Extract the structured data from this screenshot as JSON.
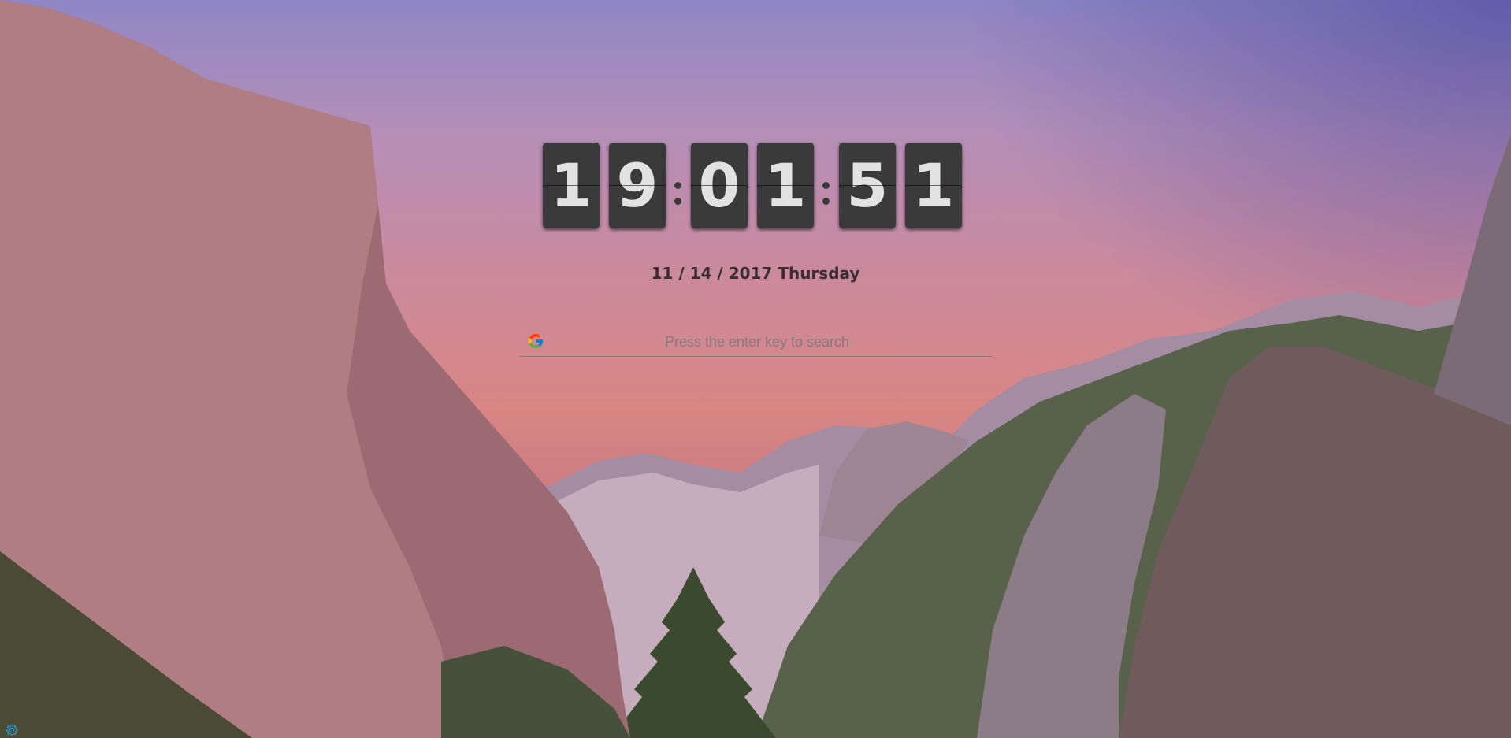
{
  "clock": {
    "h1": "1",
    "h2": "9",
    "m1": "0",
    "m2": "1",
    "s1": "5",
    "s2": "1"
  },
  "date": {
    "text": "11 / 14 / 2017 Thursday"
  },
  "search": {
    "placeholder": "Press the enter key to search",
    "value": "",
    "engine_icon": "google-icon"
  },
  "settings": {
    "icon": "gear-icon"
  },
  "colors": {
    "digit_bg": "#3a3a3a",
    "digit_text": "#e2e2e2",
    "date_text": "#3a2e36"
  }
}
